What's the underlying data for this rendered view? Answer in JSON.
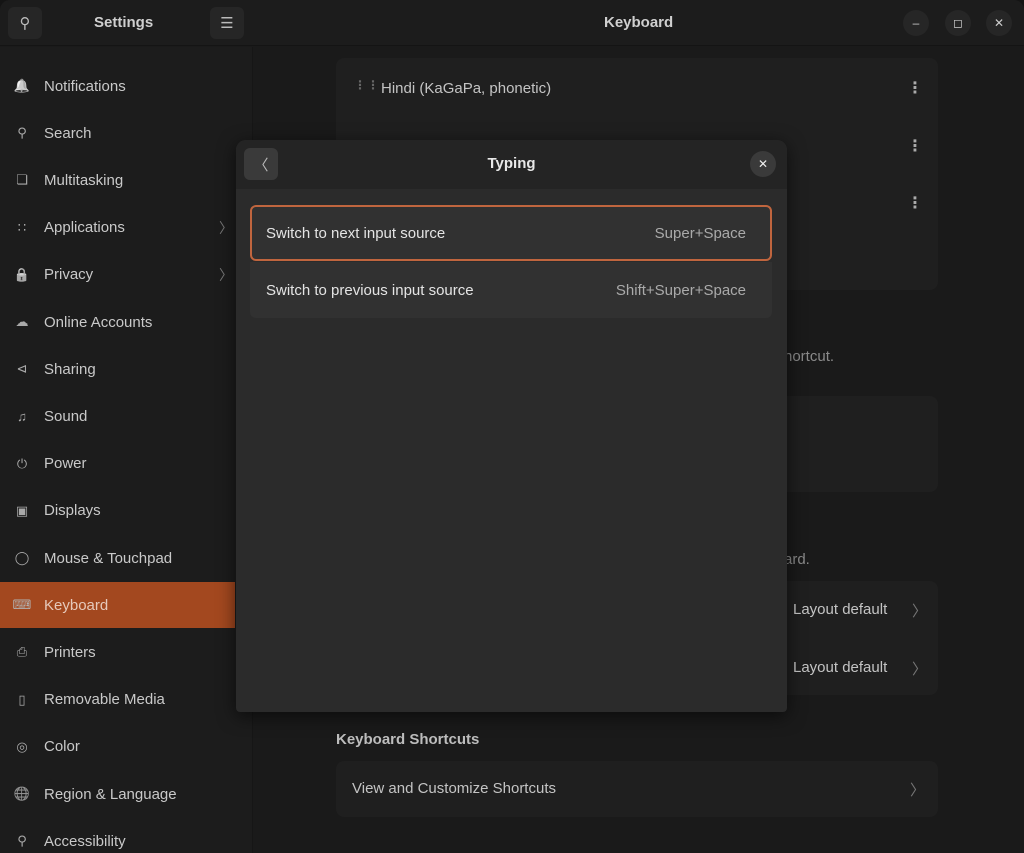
{
  "header": {
    "sidebar_title": "Settings",
    "page_title": "Keyboard"
  },
  "sidebar": {
    "items": [
      {
        "label": "Notifications",
        "icon": "bell-icon"
      },
      {
        "label": "Search",
        "icon": "search-icon"
      },
      {
        "label": "Multitasking",
        "icon": "multitasking-icon"
      },
      {
        "label": "Applications",
        "icon": "apps-grid-icon",
        "has_chevron": true
      },
      {
        "label": "Privacy",
        "icon": "lock-icon",
        "has_chevron": true
      },
      {
        "label": "Online Accounts",
        "icon": "cloud-icon"
      },
      {
        "label": "Sharing",
        "icon": "share-icon"
      },
      {
        "label": "Sound",
        "icon": "music-note-icon"
      },
      {
        "label": "Power",
        "icon": "power-icon"
      },
      {
        "label": "Displays",
        "icon": "display-icon"
      },
      {
        "label": "Mouse & Touchpad",
        "icon": "mouse-icon"
      },
      {
        "label": "Keyboard",
        "icon": "keyboard-icon",
        "active": true
      },
      {
        "label": "Printers",
        "icon": "printer-icon"
      },
      {
        "label": "Removable Media",
        "icon": "usb-icon"
      },
      {
        "label": "Color",
        "icon": "color-icon"
      },
      {
        "label": "Region & Language",
        "icon": "globe-icon"
      },
      {
        "label": "Accessibility",
        "icon": "accessibility-icon"
      }
    ]
  },
  "main": {
    "input_sources": [
      {
        "label": "Hindi (KaGaPa, phonetic)"
      }
    ],
    "partial_text_1": "hortcut.",
    "partial_text_2": "ard.",
    "special_rows": [
      {
        "value": "Layout default"
      },
      {
        "value": "Layout default"
      }
    ],
    "shortcuts_heading": "Keyboard Shortcuts",
    "shortcuts_row": "View and Customize Shortcuts"
  },
  "dialog": {
    "title": "Typing",
    "rows": [
      {
        "label": "Switch to next input source",
        "accel": "Super+Space",
        "focused": true
      },
      {
        "label": "Switch to previous input source",
        "accel": "Shift+Super+Space"
      }
    ]
  },
  "colors": {
    "accent": "#a3481f",
    "focus_ring": "#c0653e"
  }
}
